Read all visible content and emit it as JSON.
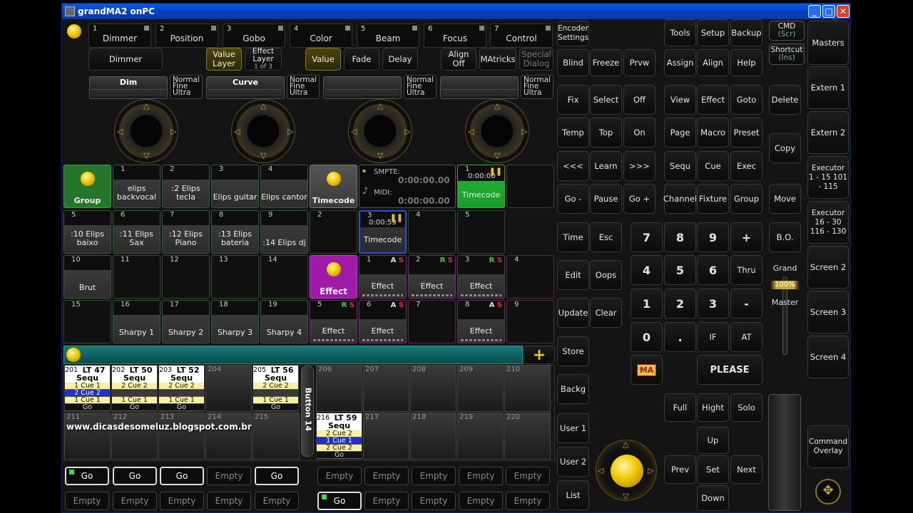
{
  "window": {
    "title": "grandMA2 onPC",
    "min": "_",
    "max": "□",
    "close": "✕"
  },
  "tabs": [
    {
      "n": "1",
      "l": "Dimmer"
    },
    {
      "n": "2",
      "l": "Position"
    },
    {
      "n": "3",
      "l": "Gobo"
    },
    {
      "n": "4",
      "l": "Color"
    },
    {
      "n": "5",
      "l": "Beam"
    },
    {
      "n": "6",
      "l": "Focus"
    },
    {
      "n": "7",
      "l": "Control"
    }
  ],
  "row2": {
    "dimmer": "Dimmer",
    "value_layer": "Value Layer",
    "effect_layer": "Effect Layer",
    "effect_layer_sub": "1 of 3",
    "value": "Value",
    "fade": "Fade",
    "delay": "Delay",
    "align": "Align Off",
    "matricks": "MAtricks",
    "special": "Special Dialog"
  },
  "encoders": [
    {
      "name": "Dim",
      "res": [
        "Normal",
        "Fine",
        "Ultra"
      ]
    },
    {
      "name": "Curve",
      "res": [
        "Normal",
        "Fine",
        "Ultra"
      ]
    },
    {
      "name": "",
      "res": [
        "Normal",
        "Fine",
        "Ultra"
      ]
    },
    {
      "name": "",
      "res": [
        "Normal",
        "Fine",
        "Ultra"
      ]
    }
  ],
  "grid": {
    "group_label": "Group",
    "groups": [
      {
        "n": "1",
        "l": "elips backvocal"
      },
      {
        "n": "2",
        "l": ":2 Elips tecla"
      },
      {
        "n": "3",
        "l": "Elips guitar"
      },
      {
        "n": "4",
        "l": "Elips cantor"
      },
      {
        "n": "5",
        "l": ":10 Elips baixo"
      },
      {
        "n": "6",
        "l": ":11 Elips Sax"
      },
      {
        "n": "7",
        "l": ":12 Elips Piano"
      },
      {
        "n": "8",
        "l": ":13 Elips bateria"
      },
      {
        "n": "9",
        "l": ":14 Elips dj"
      },
      {
        "n": "10",
        "l": "Brut"
      },
      {
        "n": "11",
        "l": ""
      },
      {
        "n": "12",
        "l": ""
      },
      {
        "n": "13",
        "l": ""
      },
      {
        "n": "14",
        "l": ""
      },
      {
        "n": "15",
        "l": ""
      },
      {
        "n": "16",
        "l": "Sharpy 1"
      },
      {
        "n": "17",
        "l": "Sharpy 2"
      },
      {
        "n": "18",
        "l": "Sharpy 3"
      },
      {
        "n": "19",
        "l": "Sharpy 4"
      }
    ],
    "timecode_label": "Timecode",
    "smpte_label": "SMPTE:",
    "smpte_val": "0:00:00.00",
    "midi_label": "MIDI:",
    "midi_val": "0:00:00.00",
    "tc1": {
      "n": "1",
      "time": "0:00:00",
      "l": "Timecode"
    },
    "tc2": {
      "n": "2"
    },
    "tc3": {
      "n": "3",
      "time": "0:00:59",
      "l": "Timecode"
    },
    "tc4": {
      "n": "4"
    },
    "tc5": {
      "n": "5"
    },
    "effect_label": "Effect",
    "effects": [
      {
        "n": "1",
        "f1": "A",
        "f2": "S",
        "l": "Effect"
      },
      {
        "n": "2",
        "f1": "R",
        "f2": "S",
        "l": "Effect"
      },
      {
        "n": "3",
        "f1": "R",
        "f2": "S",
        "l": "Effect"
      },
      {
        "n": "4",
        "f1": "",
        "f2": "",
        "l": ""
      },
      {
        "n": "5",
        "f1": "R",
        "f2": "S",
        "l": "Effect"
      },
      {
        "n": "6",
        "f1": "A",
        "f2": "S",
        "l": "Effect"
      },
      {
        "n": "7",
        "f1": "",
        "f2": "",
        "l": ""
      },
      {
        "n": "8",
        "f1": "A",
        "f2": "S",
        "l": "Effect"
      },
      {
        "n": "9",
        "f1": "",
        "f2": "",
        "l": ""
      }
    ]
  },
  "plus": "+",
  "executors": {
    "e201": {
      "n": "201",
      "lt": "LT 47",
      "t": "Sequ",
      "r": [
        "1 Cue 1",
        "2 Cue 2",
        "1 Cue 1"
      ],
      "go": "Go"
    },
    "e202": {
      "n": "202",
      "lt": "LT 50",
      "t": "Sequ",
      "r": [
        "2 Cue 2",
        "",
        "1 Cue 1"
      ],
      "go": "Go"
    },
    "e203": {
      "n": "203",
      "lt": "LT 52",
      "t": "Sequ",
      "r": [
        "2 Cue 2",
        "",
        "1 Cue 1"
      ],
      "go": "Go"
    },
    "e205": {
      "n": "205",
      "lt": "LT 56",
      "t": "Sequ",
      "r": [
        "2 Cue 2",
        "",
        "1 Cue 1"
      ],
      "go": "Go"
    },
    "e216": {
      "n": "216",
      "lt": "LT 59",
      "t": "Sequ",
      "r": [
        "2 Cue 2",
        "1 Cue 1",
        "2 Cue 2"
      ],
      "go": "Go"
    },
    "slots": [
      "204",
      "206",
      "207",
      "208",
      "209",
      "210",
      "211",
      "212",
      "213",
      "214",
      "215",
      "217",
      "218",
      "219",
      "220"
    ],
    "button14": "Button 14",
    "url": "www.dicasdesomeluz.blogspot.com.br"
  },
  "gorow1": [
    "Go",
    "Go",
    "Go",
    "Empty",
    "Go",
    "Empty",
    "Empty",
    "Empty",
    "Empty",
    "Empty"
  ],
  "gorow2": [
    "Empty",
    "Empty",
    "Empty",
    "Empty",
    "Empty",
    "Go",
    "Empty",
    "Empty",
    "Empty",
    "Empty"
  ],
  "keys": {
    "encoder_settings": "Encoder Settings",
    "blind": "Blind",
    "freeze": "Freeze",
    "prvw": "Prvw",
    "fix": "Fix",
    "select": "Select",
    "off": "Off",
    "temp": "Temp",
    "top": "Top",
    "on": "On",
    "prev3": "<<<",
    "learn": "Learn",
    "next3": ">>>",
    "gominus": "Go -",
    "pause": "Pause",
    "goplus": "Go +",
    "time": "Time",
    "esc": "Esc",
    "edit": "Edit",
    "oops": "Oops",
    "update": "Update",
    "clear": "Clear",
    "store": "Store",
    "backg": "Backg",
    "user1": "User 1",
    "user2": "User 2",
    "list": "List",
    "tools": "Tools",
    "setup": "Setup",
    "backup": "Backup",
    "assign": "Assign",
    "align": "Align",
    "help": "Help",
    "view": "View",
    "effect": "Effect",
    "goto": "Goto",
    "page": "Page",
    "macro": "Macro",
    "preset": "Preset",
    "sequ": "Sequ",
    "cue": "Cue",
    "exec": "Exec",
    "channel": "Channel",
    "fixture": "Fixture",
    "group": "Group",
    "k7": "7",
    "k8": "8",
    "k9": "9",
    "kplus": "+",
    "k4": "4",
    "k5": "5",
    "k6": "6",
    "thru": "Thru",
    "k1": "1",
    "k2": "2",
    "k3": "3",
    "kminus": "-",
    "k0": "0",
    "kdot": ".",
    "if": "IF",
    "at": "AT",
    "ma": "MA",
    "please": "PLEASE",
    "full": "Full",
    "hight": "Hight",
    "solo": "Solo",
    "up": "Up",
    "prev": "Prev",
    "set": "Set",
    "next": "Next",
    "down": "Down",
    "cmd": "CMD",
    "cmd_sub": "(Scr)",
    "shortcut": "Shortcut",
    "shortcut_sub": "(Ins)",
    "delete": "Delete",
    "copy": "Copy",
    "move": "Move",
    "bo": "B.O.",
    "grand": "Grand",
    "grand_val": "100%",
    "master": "Master"
  },
  "side": {
    "masters": "Masters",
    "extern1": "Extern 1",
    "extern2": "Extern 2",
    "exec1": "Executor 1 - 15 101 - 115",
    "exec2": "Executor 16 - 30 116 - 130",
    "screen2": "Screen 2",
    "screen3": "Screen 3",
    "screen4": "Screen 4",
    "cmd_overlay": "Command Overlay"
  }
}
